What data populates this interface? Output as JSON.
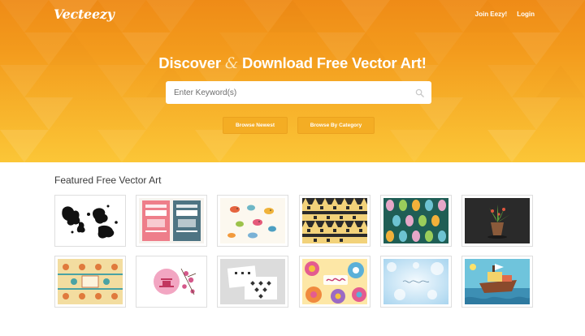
{
  "brand": {
    "name": "Vecteezy"
  },
  "nav": {
    "join_label": "Join Eezy!",
    "login_label": "Login"
  },
  "hero": {
    "headline_part1": "Discover",
    "headline_amp": "&",
    "headline_part2": "Download Free Vector Art!"
  },
  "search": {
    "placeholder": "Enter Keyword(s)",
    "value": "",
    "icon": "search-icon"
  },
  "buttons": {
    "browse_newest": "Browse Newest",
    "browse_category": "Browse By Category"
  },
  "featured": {
    "title": "Featured Free Vector Art",
    "thumbnails": [
      {
        "label": "ink-splatter-map"
      },
      {
        "label": "lorem-ipsum-posters"
      },
      {
        "label": "cartoon-birds"
      },
      {
        "label": "tribal-pattern-stripes"
      },
      {
        "label": "leaf-pattern"
      },
      {
        "label": "potted-plant-dark"
      },
      {
        "label": "ornamental-pattern"
      },
      {
        "label": "pink-pagoda-card"
      },
      {
        "label": "monochrome-pattern-cards"
      },
      {
        "label": "spring-flowers"
      },
      {
        "label": "bokeh-background"
      },
      {
        "label": "cartoon-ship-scene"
      }
    ]
  },
  "colors": {
    "hero_top": "#ef8b17",
    "hero_bottom": "#fbc637",
    "button": "#f4ad24",
    "text": "#3a3a3a"
  }
}
